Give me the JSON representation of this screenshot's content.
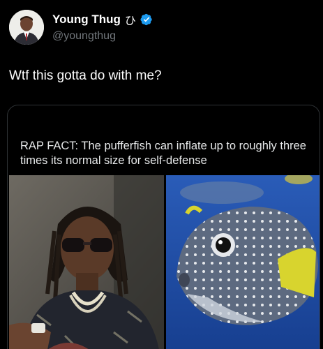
{
  "author": {
    "display_name": "Young Thug",
    "name_glyph": "ひ",
    "handle": "@youngthug",
    "verified": true,
    "avatar_icon": "profile-photo"
  },
  "tweet": {
    "text": "Wtf this gotta do with me?"
  },
  "quoted_card": {
    "text": "RAP FACT: The pufferfish can inflate up to roughly three times its normal size for self-defense",
    "images": [
      "rapper-photo",
      "pufferfish-photo"
    ]
  },
  "colors": {
    "background": "#000000",
    "verified_badge": "#1d9bf0",
    "handle_gray": "#71767b",
    "card_border": "#2f3336",
    "water_blue": "#1f4fa8"
  }
}
